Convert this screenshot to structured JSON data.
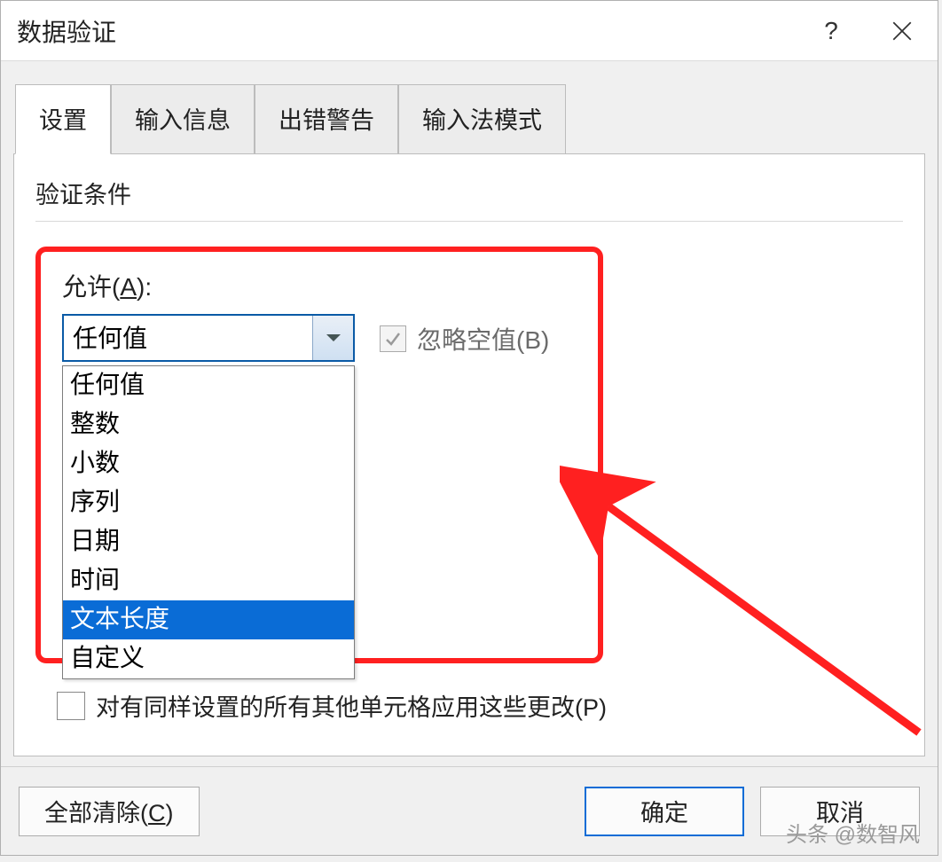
{
  "dialog": {
    "title": "数据验证"
  },
  "tabs": {
    "items": [
      {
        "label": "设置"
      },
      {
        "label": "输入信息"
      },
      {
        "label": "出错警告"
      },
      {
        "label": "输入法模式"
      }
    ]
  },
  "panel": {
    "section_title": "验证条件",
    "allow_label_prefix": "允许(",
    "allow_label_key": "A",
    "allow_label_suffix": "):",
    "combo_value": "任何值",
    "ignore_blank_label": "忽略空值(B)",
    "apply_changes_label": "对有同样设置的所有其他单元格应用这些更改(P)"
  },
  "dropdown": {
    "items": [
      {
        "label": "任何值"
      },
      {
        "label": "整数"
      },
      {
        "label": "小数"
      },
      {
        "label": "序列"
      },
      {
        "label": "日期"
      },
      {
        "label": "时间"
      },
      {
        "label": "文本长度"
      },
      {
        "label": "自定义"
      }
    ],
    "selected_index": 6
  },
  "buttons": {
    "clear_all_prefix": "全部清除(",
    "clear_all_key": "C",
    "clear_all_suffix": ")",
    "ok": "确定",
    "cancel": "取消"
  },
  "watermark": "头条 @数智风"
}
